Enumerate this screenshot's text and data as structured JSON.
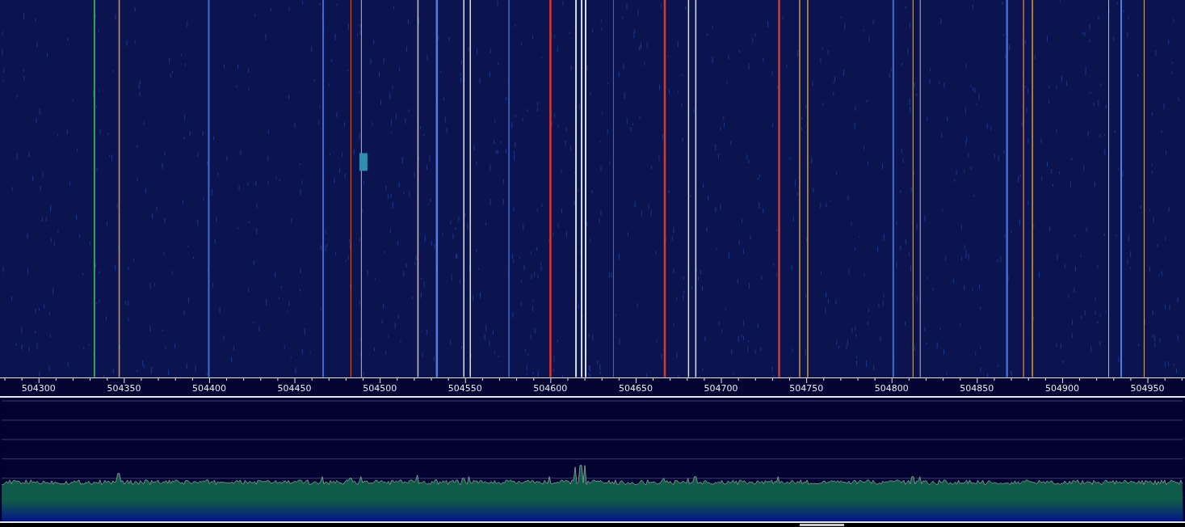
{
  "frequency_axis": {
    "labels": [
      "504300",
      "504350",
      "504400",
      "504450",
      "504500",
      "504550",
      "504600",
      "504650",
      "504700",
      "504750",
      "504800",
      "504850",
      "504900",
      "504950"
    ]
  }
}
